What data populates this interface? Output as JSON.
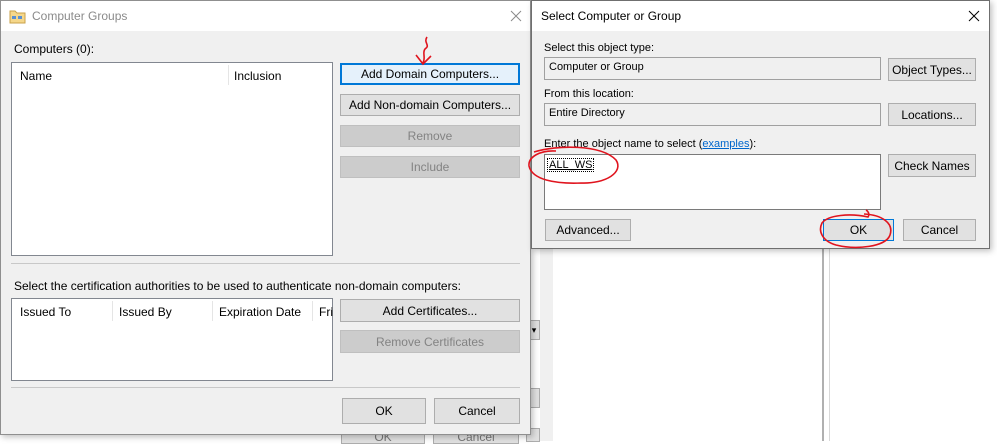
{
  "computer_groups": {
    "title": "Computer Groups",
    "computers_label": "Computers (0):",
    "computers_columns": [
      "Name",
      "Inclusion"
    ],
    "buttons": {
      "add_domain": "Add Domain Computers...",
      "add_non_domain": "Add Non-domain Computers...",
      "remove": "Remove",
      "include": "Include"
    },
    "ca_label": "Select the certification authorities to be used to authenticate non-domain computers:",
    "cert_columns": [
      "Issued To",
      "Issued By",
      "Expiration Date",
      "Fri"
    ],
    "cert_buttons": {
      "add": "Add Certificates...",
      "remove": "Remove Certificates"
    },
    "ok": "OK",
    "cancel": "Cancel"
  },
  "select_dialog": {
    "title": "Select Computer or Group",
    "object_type_label": "Select this object type:",
    "object_type_value": "Computer or Group",
    "object_types_button": "Object Types...",
    "location_label": "From this location:",
    "location_value": "Entire Directory",
    "locations_button": "Locations...",
    "enter_label_pre": "Enter the object name to select (",
    "enter_label_link": "examples",
    "enter_label_post": "):",
    "object_name_value": "ALL_WS",
    "check_names_button": "Check Names",
    "advanced_button": "Advanced...",
    "ok": "OK",
    "cancel": "Cancel"
  },
  "background": {
    "ok": "OK",
    "cancel": "Cancel"
  },
  "colors": {
    "annotation": "#e0141e",
    "link": "#0066cc",
    "focus": "#0078d7"
  }
}
